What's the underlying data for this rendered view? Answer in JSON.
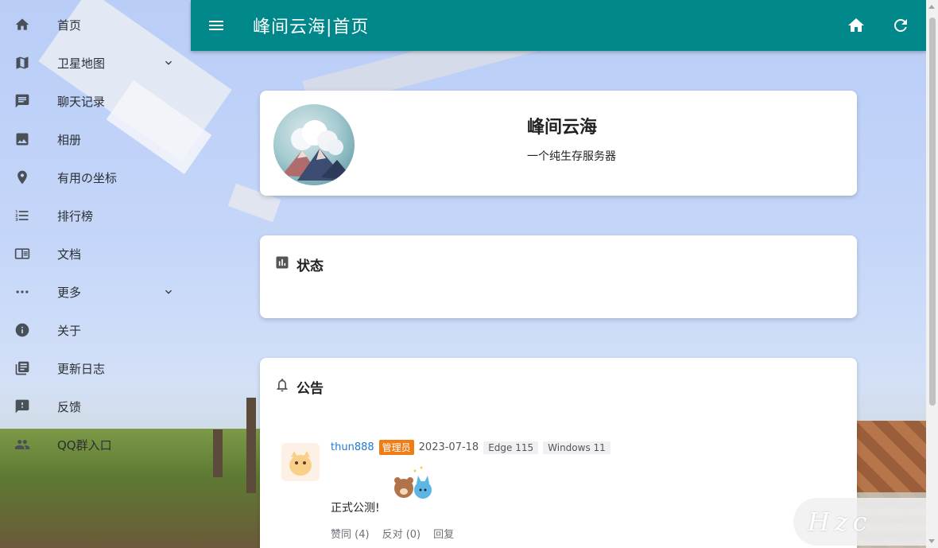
{
  "sidebar": {
    "items": [
      {
        "label": "首页",
        "icon": "home-icon"
      },
      {
        "label": "卫星地图",
        "icon": "map-icon",
        "expandable": true
      },
      {
        "label": "聊天记录",
        "icon": "chat-icon"
      },
      {
        "label": "相册",
        "icon": "image-icon"
      },
      {
        "label": "有用の坐标",
        "icon": "location-pin-icon"
      },
      {
        "label": "排行榜",
        "icon": "list-numbered-icon"
      },
      {
        "label": "文档",
        "icon": "document-icon"
      },
      {
        "label": "更多",
        "icon": "more-horiz-icon",
        "expandable": true
      },
      {
        "label": "关于",
        "icon": "info-icon"
      },
      {
        "label": "更新日志",
        "icon": "library-books-icon"
      },
      {
        "label": "反馈",
        "icon": "feedback-icon"
      },
      {
        "label": "QQ群入口",
        "icon": "people-icon"
      }
    ]
  },
  "appbar": {
    "title": "峰间云海|首页",
    "background": "#00878a"
  },
  "profile": {
    "name": "峰间云海",
    "description": "一个纯生存服务器"
  },
  "status_card": {
    "title": "状态"
  },
  "notice_card": {
    "title": "公告",
    "post": {
      "user": "thun888",
      "role_badge": "管理员",
      "date": "2023-07-18",
      "browser": "Edge 115",
      "os": "Windows 11",
      "text": "正式公测!",
      "like_label": "赞同 (4)",
      "dislike_label": "反对 (0)",
      "reply_label": "回复"
    }
  },
  "watermark": "Hzc"
}
